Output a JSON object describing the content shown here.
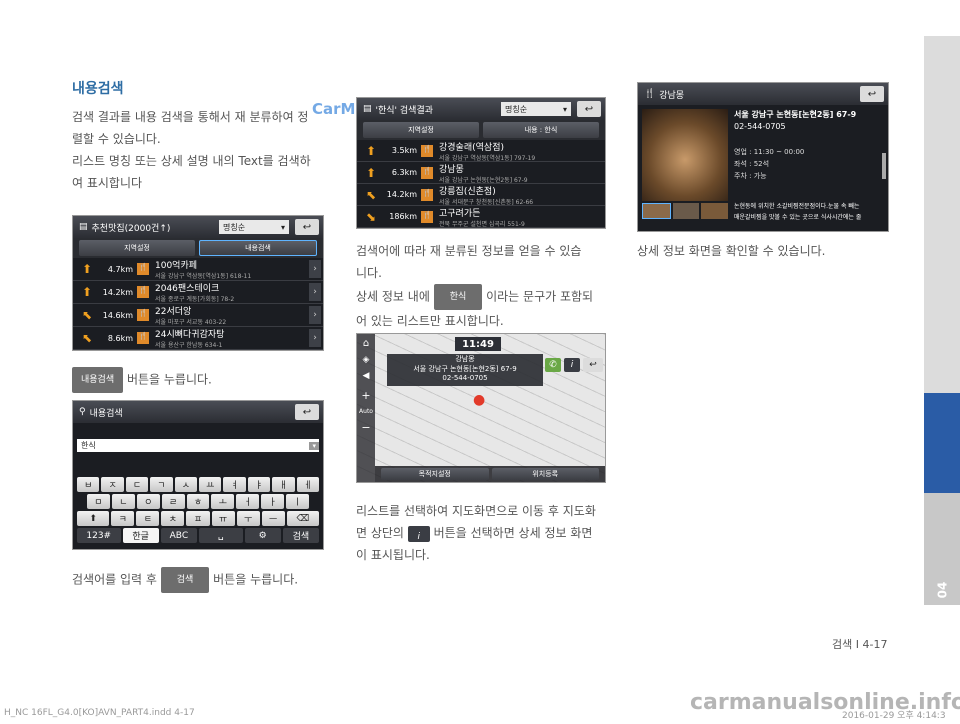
{
  "section_title": "내용검색",
  "intro": {
    "line1": "검색 결과를 내용 검색을 통해서 재 분류하여 정",
    "line2": "렬할 수 있습니다.",
    "line3": "리스트 명칭 또는 상세 설명 내의 Text를 검색하",
    "line4": "여 표시합니다"
  },
  "shot1": {
    "title": "추천맛집(2000건↑)",
    "sort": "명칭순",
    "tab_left": "지역설정",
    "tab_right": "내용검색",
    "rows": [
      {
        "dist": "4.7km",
        "name": "100억카페",
        "addr": "서울 강남구 역삼동[역삼1동] 618-11"
      },
      {
        "dist": "14.2km",
        "name": "2046팬스테이크",
        "addr": "서울 종로구 계동[가회동] 78-2"
      },
      {
        "dist": "14.6km",
        "name": "22서더앙",
        "addr": "서울 마포구 서교동 403-22"
      },
      {
        "dist": "8.6km",
        "name": "24시뼈다귀감자탕",
        "addr": "서울 용산구 한남동 634-1"
      }
    ]
  },
  "caption1": {
    "button": "내용검색",
    "text": "버튼을 누릅니다."
  },
  "shot2": {
    "title": "내용검색",
    "input_value": "한식",
    "keys_row1": [
      "ㅂ",
      "ㅈ",
      "ㄷ",
      "ㄱ",
      "ㅅ",
      "ㅛ",
      "ㅕ",
      "ㅑ",
      "ㅐ",
      "ㅔ"
    ],
    "keys_row2": [
      "ㅁ",
      "ㄴ",
      "ㅇ",
      "ㄹ",
      "ㅎ",
      "ㅗ",
      "ㅓ",
      "ㅏ",
      "ㅣ"
    ],
    "keys_row3": [
      "⬆",
      "ㅋ",
      "ㅌ",
      "ㅊ",
      "ㅍ",
      "ㅠ",
      "ㅜ",
      "ㅡ",
      "⌫"
    ],
    "keys_row4": [
      "123#",
      "한글",
      "ABC",
      "␣",
      "⚙",
      "검색"
    ]
  },
  "caption2": {
    "pre": "검색어를 입력 후",
    "button": "검색",
    "post": "버튼을 누릅니다."
  },
  "shot3": {
    "title": "'한식' 검색결과",
    "sort": "명칭순",
    "tab_left": "지역설정",
    "tab_right": "내용 : 한식",
    "rows": [
      {
        "dist": "3.5km",
        "name": "강경술래(역삼점)",
        "addr": "서울 강남구 역삼동[역삼1동] 797-19"
      },
      {
        "dist": "6.3km",
        "name": "강남몽",
        "addr": "서울 강남구 논현동[논현2동] 67-9"
      },
      {
        "dist": "14.2km",
        "name": "강릉집(신촌점)",
        "addr": "서울 서대문구 창천동[신촌동] 62-66"
      },
      {
        "dist": "186km",
        "name": "고구려가든",
        "addr": "전북 무주군 설천면 심곡리 551-9"
      }
    ]
  },
  "col2": {
    "p1_l1": "검색어에 따라 재 분류된 정보를 얻을 수 있습",
    "p1_l2": "니다.",
    "p2_pre": "상세 정보 내에",
    "p2_btn": "한식",
    "p2_post": "이라는 문구가 포함되",
    "p2_l2": "어 있는 리스트만 표시합니다."
  },
  "map": {
    "time": "11:49",
    "place": "강남몽",
    "addr": "서울 강남구 논현동[논현2동] 67-9",
    "phone": "02-544-0705",
    "btn_left": "목적지설정",
    "btn_right": "위치등록",
    "side_auto": "Auto"
  },
  "col2b": {
    "p1_l1": "리스트를 선택하여 지도화면으로 이동 후 지도화",
    "p1_pre": "면 상단의",
    "p1_post": "버튼을 선택하면 상세 정보 화면",
    "p1_l3": "이 표시됩니다."
  },
  "shot4": {
    "title": "강남몽",
    "addr": "서울 강남구 논현동[논현2동] 67-9",
    "phone": "02-544-0705",
    "hours": "영업 : 11:30 ~ 00:00",
    "seats": "좌석 : 52석",
    "parking": "주차 : 가능",
    "desc1": "논현동에 위치한 소갈비찜전문점이다.눈물 속 빼는",
    "desc2": "매운갈비찜을 맛볼 수 있는 곳으로 식사시간에는 줄"
  },
  "col3": {
    "caption": "상세 정보 화면을 확인할 수 있습니다."
  },
  "sidebar": {
    "chapter": "04"
  },
  "page": {
    "label": "검색 I 4-17"
  },
  "footer": {
    "left": "H_NC 16FL_G4.0[KO]AVN_PART4.indd   4-17",
    "right": "2016-01-29   오후 4:14:3"
  },
  "watermark": {
    "top": "CarManuals2.com",
    "bottom": "carmanualsonline.info"
  },
  "colors": {
    "accent": "#2e6da4",
    "sidebar": "#2a5ca6",
    "select": "#5fb4ff"
  }
}
